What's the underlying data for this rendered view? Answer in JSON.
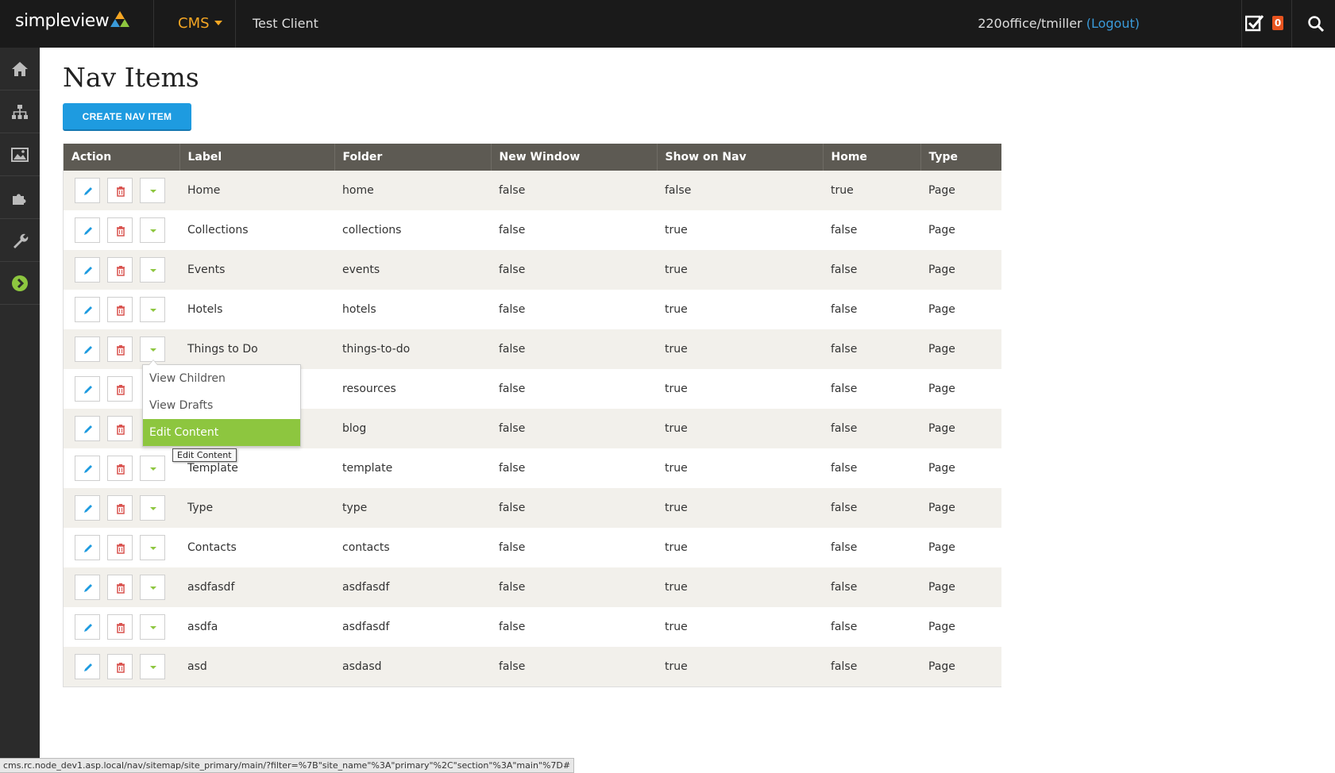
{
  "header": {
    "logo_text": "simpleview",
    "cms_label": "CMS",
    "client_name": "Test Client",
    "user": "220office/tmiller",
    "logout_label": "(Logout)",
    "task_count": "0"
  },
  "sidebar": {
    "items": [
      {
        "icon": "home-icon"
      },
      {
        "icon": "sitemap-icon"
      },
      {
        "icon": "image-icon"
      },
      {
        "icon": "puzzle-icon"
      },
      {
        "icon": "wrench-icon"
      },
      {
        "icon": "arrow-circle-icon"
      }
    ]
  },
  "page": {
    "title": "Nav Items",
    "create_button": "CREATE NAV ITEM"
  },
  "table": {
    "columns": [
      "Action",
      "Label",
      "Folder",
      "New Window",
      "Show on Nav",
      "Home",
      "Type"
    ],
    "rows": [
      {
        "label": "Home",
        "folder": "home",
        "new_window": "false",
        "show_on_nav": "false",
        "home": "true",
        "type": "Page"
      },
      {
        "label": "Collections",
        "folder": "collections",
        "new_window": "false",
        "show_on_nav": "true",
        "home": "false",
        "type": "Page"
      },
      {
        "label": "Events",
        "folder": "events",
        "new_window": "false",
        "show_on_nav": "true",
        "home": "false",
        "type": "Page"
      },
      {
        "label": "Hotels",
        "folder": "hotels",
        "new_window": "false",
        "show_on_nav": "true",
        "home": "false",
        "type": "Page"
      },
      {
        "label": "Things to Do",
        "folder": "things-to-do",
        "new_window": "false",
        "show_on_nav": "true",
        "home": "false",
        "type": "Page"
      },
      {
        "label": "",
        "folder": "resources",
        "new_window": "false",
        "show_on_nav": "true",
        "home": "false",
        "type": "Page"
      },
      {
        "label": "",
        "folder": "blog",
        "new_window": "false",
        "show_on_nav": "true",
        "home": "false",
        "type": "Page"
      },
      {
        "label": "Template",
        "folder": "template",
        "new_window": "false",
        "show_on_nav": "true",
        "home": "false",
        "type": "Page"
      },
      {
        "label": "Type",
        "folder": "type",
        "new_window": "false",
        "show_on_nav": "true",
        "home": "false",
        "type": "Page"
      },
      {
        "label": "Contacts",
        "folder": "contacts",
        "new_window": "false",
        "show_on_nav": "true",
        "home": "false",
        "type": "Page"
      },
      {
        "label": "asdfasdf",
        "folder": "asdfasdf",
        "new_window": "false",
        "show_on_nav": "true",
        "home": "false",
        "type": "Page"
      },
      {
        "label": "asdfa",
        "folder": "asdfasdf",
        "new_window": "false",
        "show_on_nav": "true",
        "home": "false",
        "type": "Page"
      },
      {
        "label": "asd",
        "folder": "asdasd",
        "new_window": "false",
        "show_on_nav": "true",
        "home": "false",
        "type": "Page"
      }
    ]
  },
  "dropdown": {
    "items": [
      "View Children",
      "View Drafts",
      "Edit Content"
    ],
    "active": "Edit Content"
  },
  "tooltip": "Edit Content",
  "statusbar": "cms.rc.node_dev1.asp.local/nav/sitemap/site_primary/main/?filter=%7B\"site_name\"%3A\"primary\"%2C\"section\"%3A\"main\"%7D#",
  "colors": {
    "edit": "#1e9be0",
    "delete": "#d9534f",
    "expand": "#8dc63f",
    "header_bg": "#5d5a53",
    "cms_accent": "#f5a623"
  }
}
